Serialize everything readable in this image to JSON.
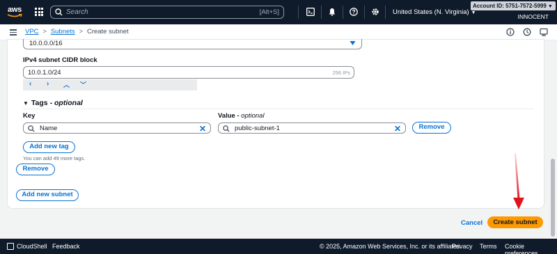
{
  "topnav": {
    "logo_text": "aws",
    "search_placeholder": "Search",
    "search_shortcut": "[Alt+S]",
    "region": "United States (N. Virginia)",
    "account_id": "Account ID: 5751-7572-5999",
    "account_name": "INNOCENT",
    "icons": [
      "services-grid-icon",
      "search-icon",
      "cloudshell-icon",
      "bell-icon",
      "help-icon",
      "gear-icon"
    ]
  },
  "breadcrumb": {
    "items": [
      "VPC",
      "Subnets",
      "Create subnet"
    ]
  },
  "form": {
    "vpc_cidr_value": "10.0.0.0/16",
    "ipv4_label": "IPv4 subnet CIDR block",
    "ipv4_value": "10.0.1.0/24",
    "ipv4_hint": "256 IPs",
    "tags_title": "Tags",
    "tags_optional": "optional",
    "key_label": "Key",
    "value_label": "Value",
    "value_optional": "optional",
    "tag_key": "Name",
    "tag_value": "public-subnet-1",
    "remove_tag": "Remove",
    "add_tag": "Add new tag",
    "tag_note": "You can add 49 more tags.",
    "remove_subnet": "Remove",
    "add_subnet": "Add new subnet"
  },
  "actions": {
    "cancel": "Cancel",
    "create": "Create subnet"
  },
  "footer": {
    "cloudshell": "CloudShell",
    "feedback": "Feedback",
    "copyright": "© 2025, Amazon Web Services, Inc. or its affiliates.",
    "privacy": "Privacy",
    "terms": "Terms",
    "cookies": "Cookie preferences"
  },
  "colors": {
    "nav_bg": "#0f1b2a",
    "link": "#0972d3",
    "primary": "#ff9900",
    "annotation": "#e3131b"
  }
}
